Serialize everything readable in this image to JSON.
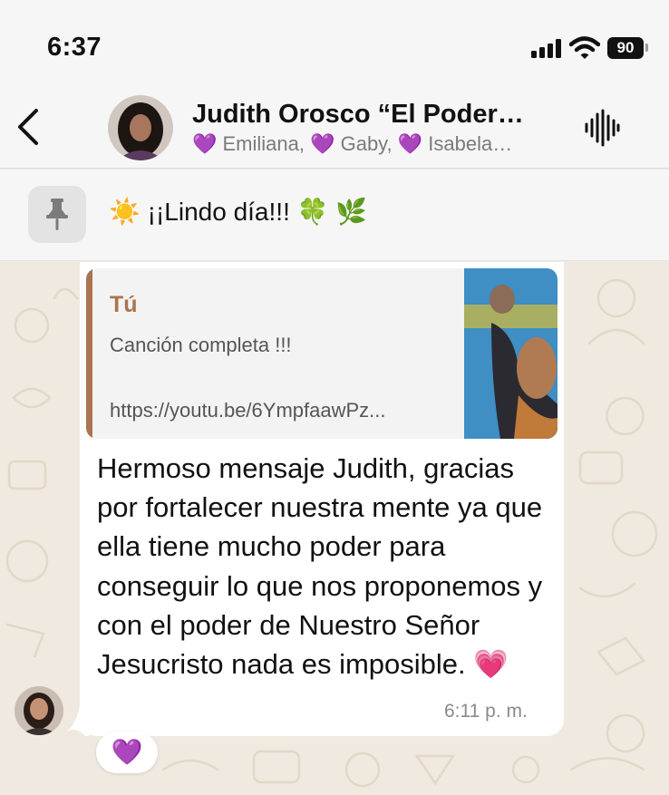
{
  "status_bar": {
    "time": "6:37",
    "battery": "90"
  },
  "header": {
    "title": "Judith Orosco “El Poder…",
    "members": "💜 Emiliana, 💜 Gaby, 💜 Isabela…"
  },
  "pinned": {
    "text": "☀️ ¡¡Lindo día!!! 🍀 🌿"
  },
  "message": {
    "quote": {
      "author": "Tú",
      "text": "Canción completa !!!",
      "link": "https://youtu.be/6YmpfaawPz..."
    },
    "text": "Hermoso mensaje Judith, gracias por fortalecer nuestra mente ya que ella tiene mucho poder para conseguir lo que nos proponemos y con el poder de Nuestro Señor Jesucristo nada es imposible. 💗",
    "time": "6:11 p. m.",
    "reaction": "💜"
  },
  "colors": {
    "quote_accent": "#a9744f",
    "chat_background": "#efe9df",
    "header_background": "#f6f6f6"
  },
  "icons": [
    "back-chevron-icon",
    "voice-waveform-icon",
    "pin-icon",
    "signal-icon",
    "wifi-icon",
    "battery-icon"
  ]
}
